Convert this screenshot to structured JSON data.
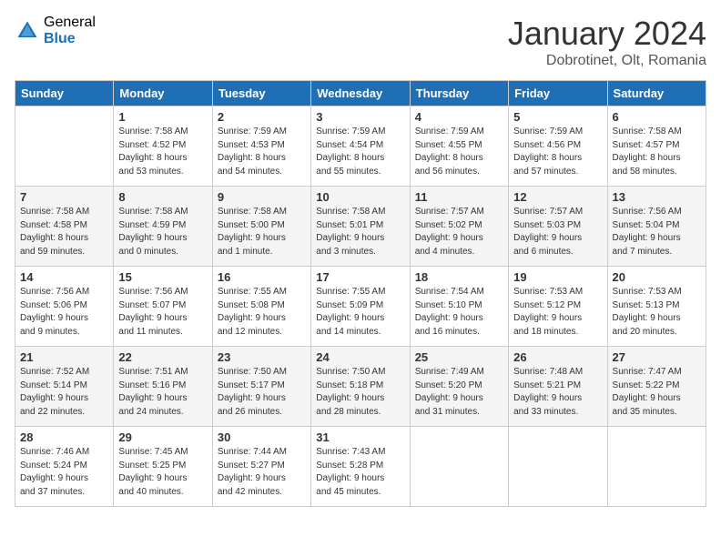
{
  "logo": {
    "general": "General",
    "blue": "Blue"
  },
  "header": {
    "title": "January 2024",
    "subtitle": "Dobrotinet, Olt, Romania"
  },
  "columns": [
    "Sunday",
    "Monday",
    "Tuesday",
    "Wednesday",
    "Thursday",
    "Friday",
    "Saturday"
  ],
  "weeks": [
    [
      {
        "day": "",
        "info": ""
      },
      {
        "day": "1",
        "info": "Sunrise: 7:58 AM\nSunset: 4:52 PM\nDaylight: 8 hours\nand 53 minutes."
      },
      {
        "day": "2",
        "info": "Sunrise: 7:59 AM\nSunset: 4:53 PM\nDaylight: 8 hours\nand 54 minutes."
      },
      {
        "day": "3",
        "info": "Sunrise: 7:59 AM\nSunset: 4:54 PM\nDaylight: 8 hours\nand 55 minutes."
      },
      {
        "day": "4",
        "info": "Sunrise: 7:59 AM\nSunset: 4:55 PM\nDaylight: 8 hours\nand 56 minutes."
      },
      {
        "day": "5",
        "info": "Sunrise: 7:59 AM\nSunset: 4:56 PM\nDaylight: 8 hours\nand 57 minutes."
      },
      {
        "day": "6",
        "info": "Sunrise: 7:58 AM\nSunset: 4:57 PM\nDaylight: 8 hours\nand 58 minutes."
      }
    ],
    [
      {
        "day": "7",
        "info": "Sunrise: 7:58 AM\nSunset: 4:58 PM\nDaylight: 8 hours\nand 59 minutes."
      },
      {
        "day": "8",
        "info": "Sunrise: 7:58 AM\nSunset: 4:59 PM\nDaylight: 9 hours\nand 0 minutes."
      },
      {
        "day": "9",
        "info": "Sunrise: 7:58 AM\nSunset: 5:00 PM\nDaylight: 9 hours\nand 1 minute."
      },
      {
        "day": "10",
        "info": "Sunrise: 7:58 AM\nSunset: 5:01 PM\nDaylight: 9 hours\nand 3 minutes."
      },
      {
        "day": "11",
        "info": "Sunrise: 7:57 AM\nSunset: 5:02 PM\nDaylight: 9 hours\nand 4 minutes."
      },
      {
        "day": "12",
        "info": "Sunrise: 7:57 AM\nSunset: 5:03 PM\nDaylight: 9 hours\nand 6 minutes."
      },
      {
        "day": "13",
        "info": "Sunrise: 7:56 AM\nSunset: 5:04 PM\nDaylight: 9 hours\nand 7 minutes."
      }
    ],
    [
      {
        "day": "14",
        "info": "Sunrise: 7:56 AM\nSunset: 5:06 PM\nDaylight: 9 hours\nand 9 minutes."
      },
      {
        "day": "15",
        "info": "Sunrise: 7:56 AM\nSunset: 5:07 PM\nDaylight: 9 hours\nand 11 minutes."
      },
      {
        "day": "16",
        "info": "Sunrise: 7:55 AM\nSunset: 5:08 PM\nDaylight: 9 hours\nand 12 minutes."
      },
      {
        "day": "17",
        "info": "Sunrise: 7:55 AM\nSunset: 5:09 PM\nDaylight: 9 hours\nand 14 minutes."
      },
      {
        "day": "18",
        "info": "Sunrise: 7:54 AM\nSunset: 5:10 PM\nDaylight: 9 hours\nand 16 minutes."
      },
      {
        "day": "19",
        "info": "Sunrise: 7:53 AM\nSunset: 5:12 PM\nDaylight: 9 hours\nand 18 minutes."
      },
      {
        "day": "20",
        "info": "Sunrise: 7:53 AM\nSunset: 5:13 PM\nDaylight: 9 hours\nand 20 minutes."
      }
    ],
    [
      {
        "day": "21",
        "info": "Sunrise: 7:52 AM\nSunset: 5:14 PM\nDaylight: 9 hours\nand 22 minutes."
      },
      {
        "day": "22",
        "info": "Sunrise: 7:51 AM\nSunset: 5:16 PM\nDaylight: 9 hours\nand 24 minutes."
      },
      {
        "day": "23",
        "info": "Sunrise: 7:50 AM\nSunset: 5:17 PM\nDaylight: 9 hours\nand 26 minutes."
      },
      {
        "day": "24",
        "info": "Sunrise: 7:50 AM\nSunset: 5:18 PM\nDaylight: 9 hours\nand 28 minutes."
      },
      {
        "day": "25",
        "info": "Sunrise: 7:49 AM\nSunset: 5:20 PM\nDaylight: 9 hours\nand 31 minutes."
      },
      {
        "day": "26",
        "info": "Sunrise: 7:48 AM\nSunset: 5:21 PM\nDaylight: 9 hours\nand 33 minutes."
      },
      {
        "day": "27",
        "info": "Sunrise: 7:47 AM\nSunset: 5:22 PM\nDaylight: 9 hours\nand 35 minutes."
      }
    ],
    [
      {
        "day": "28",
        "info": "Sunrise: 7:46 AM\nSunset: 5:24 PM\nDaylight: 9 hours\nand 37 minutes."
      },
      {
        "day": "29",
        "info": "Sunrise: 7:45 AM\nSunset: 5:25 PM\nDaylight: 9 hours\nand 40 minutes."
      },
      {
        "day": "30",
        "info": "Sunrise: 7:44 AM\nSunset: 5:27 PM\nDaylight: 9 hours\nand 42 minutes."
      },
      {
        "day": "31",
        "info": "Sunrise: 7:43 AM\nSunset: 5:28 PM\nDaylight: 9 hours\nand 45 minutes."
      },
      {
        "day": "",
        "info": ""
      },
      {
        "day": "",
        "info": ""
      },
      {
        "day": "",
        "info": ""
      }
    ]
  ]
}
